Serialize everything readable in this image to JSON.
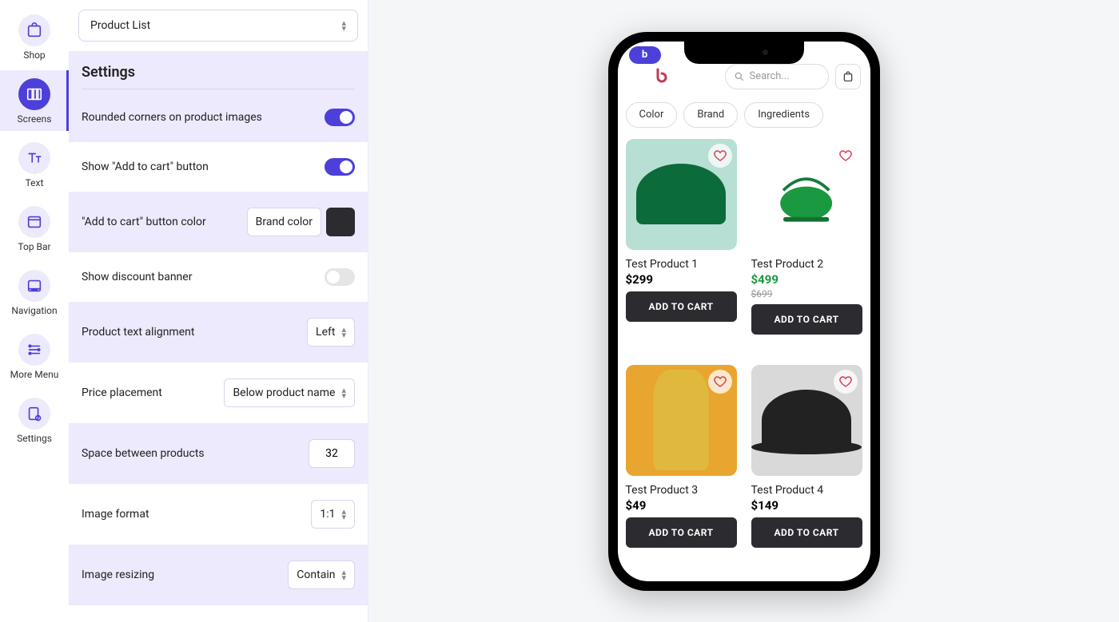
{
  "sidebar": [
    {
      "label": "Shop",
      "icon": "shop"
    },
    {
      "label": "Screens",
      "icon": "screens",
      "active": true
    },
    {
      "label": "Text",
      "icon": "text"
    },
    {
      "label": "Top Bar",
      "icon": "topbar"
    },
    {
      "label": "Navigation",
      "icon": "nav"
    },
    {
      "label": "More Menu",
      "icon": "moremenu"
    },
    {
      "label": "Settings",
      "icon": "settings"
    }
  ],
  "panel": {
    "screenSelect": "Product List",
    "heading": "Settings",
    "rows": {
      "roundedCorners": {
        "label": "Rounded corners on product images",
        "on": true
      },
      "showAtc": {
        "label": "Show \"Add to cart\" button",
        "on": true
      },
      "atcColor": {
        "label": "\"Add to cart\" button color",
        "value": "Brand color",
        "swatch": "#2b2b30"
      },
      "discountBanner": {
        "label": "Show discount banner",
        "on": false
      },
      "textAlign": {
        "label": "Product text alignment",
        "value": "Left"
      },
      "pricePlacement": {
        "label": "Price placement",
        "value": "Below product name"
      },
      "spaceBetween": {
        "label": "Space between products",
        "value": "32"
      },
      "imageFormat": {
        "label": "Image format",
        "value": "1:1"
      },
      "imageResizing": {
        "label": "Image resizing",
        "value": "Contain"
      }
    }
  },
  "phone": {
    "searchPlaceholder": "Search...",
    "filters": [
      "Color",
      "Brand",
      "Ingredients"
    ],
    "atcLabel": "ADD TO CART",
    "products": [
      {
        "name": "Test Product 1",
        "price": "$299",
        "bg": "#b8dfd4"
      },
      {
        "name": "Test Product 2",
        "price": "$499",
        "oldPrice": "$699",
        "green": true,
        "bg": "#ffffff"
      },
      {
        "name": "Test Product 3",
        "price": "$49",
        "bg": "#e8a530"
      },
      {
        "name": "Test Product 4",
        "price": "$149",
        "bg": "#d9d9d9"
      }
    ]
  }
}
